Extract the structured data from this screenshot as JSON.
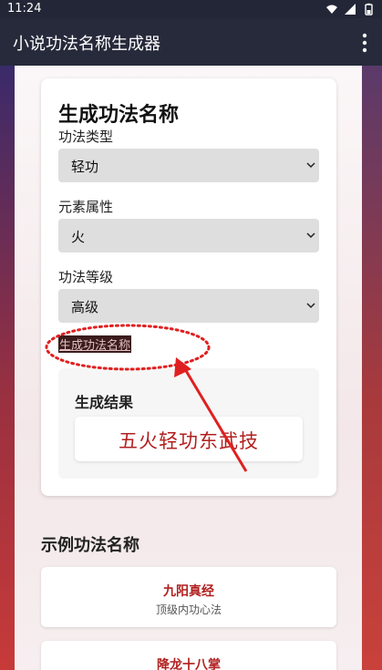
{
  "status_bar": {
    "time": "11:24",
    "icons": [
      "wifi-icon",
      "signal-icon",
      "battery-icon"
    ]
  },
  "app_bar": {
    "title": "小说功法名称生成器",
    "menu_icon": "more-vert-icon"
  },
  "form": {
    "title": "生成功法名称",
    "fields": [
      {
        "label": "功法类型",
        "value": "轻功"
      },
      {
        "label": "元素属性",
        "value": "火"
      },
      {
        "label": "功法等级",
        "value": "高级"
      }
    ],
    "generate_link": "生成功法名称"
  },
  "result": {
    "heading": "生成结果",
    "value": "五火轻功东武技"
  },
  "examples": {
    "title": "示例功法名称",
    "items": [
      {
        "name": "九阳真经",
        "desc": "顶级内功心法"
      },
      {
        "name": "降龙十八掌",
        "desc": ""
      }
    ]
  },
  "colors": {
    "app_bar": "#262a3b",
    "accent_red": "#b12020",
    "annotation_red": "#e02020"
  }
}
